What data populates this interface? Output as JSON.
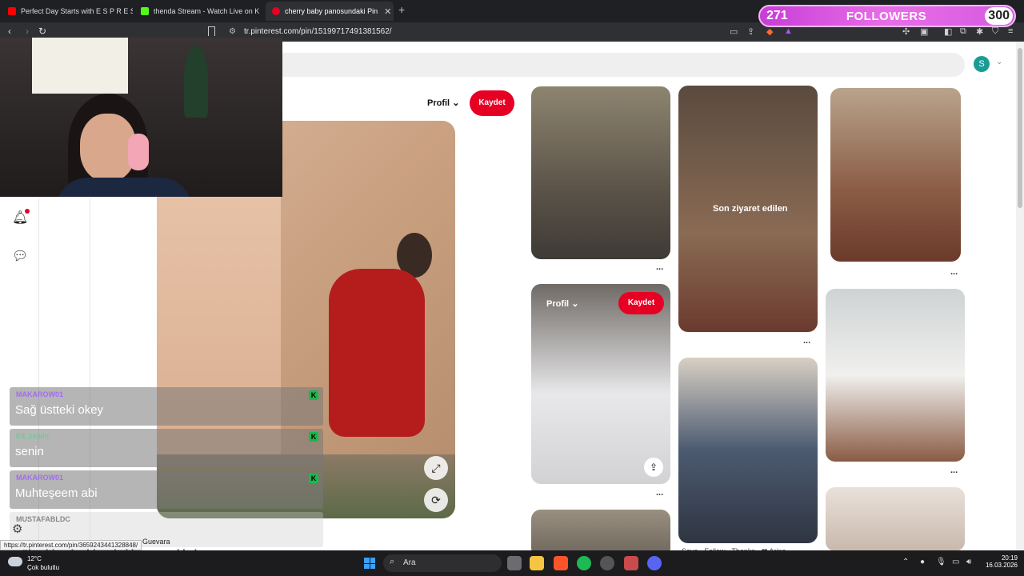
{
  "browser": {
    "tabs": [
      {
        "title": "Perfect Day Starts with E S P R E S S O",
        "icon_color": "#ff0000",
        "active": false
      },
      {
        "title": "thenda Stream - Watch Live on K",
        "icon_color": "#53fc18",
        "active": false
      },
      {
        "title": "cherry baby panosundaki Pin",
        "icon_color": "#e60023",
        "active": true
      }
    ],
    "url": "tr.pinterest.com/pin/151997174913815​62/",
    "status_url": "https://tr.pinterest.com/pin/36592434413288​48/"
  },
  "followers_widget": {
    "current": "271",
    "label": "FOLLOWERS",
    "goal": "300"
  },
  "pinterest": {
    "avatar_letter": "S",
    "pin": {
      "profile_label": "Profil",
      "save_label": "Kaydet"
    },
    "grid": {
      "recently_visited": "Son ziyaret edilen",
      "hover_profile": "Profil",
      "hover_save": "Kaydet",
      "more": "...",
      "footer_text": "Save · Follow · Thanks · ❤ Arina"
    }
  },
  "chat": [
    {
      "user": "MAKAROW01",
      "user_color": "#a46cf0",
      "text": "Sağ üstteki okey"
    },
    {
      "user": "Ell_zelvin",
      "user_color": "#5fd38f",
      "text": "senin"
    },
    {
      "user": "MAKAROW01",
      "user_color": "#a46cf0",
      "text": "Muhteşeem abi"
    },
    {
      "user": "MUSTAFABLDC",
      "user_color": "#888888",
      "text": "Guevara"
    }
  ],
  "chat_tail_text": "yükseltiyorlar biz erkekler paspal kalıyoruz",
  "taskbar": {
    "weather_temp": "12°C",
    "weather_desc": "Çok bulutlu",
    "search_label": "Ara",
    "time": "20:19",
    "date": "16.03.2026"
  },
  "colors": {
    "pinterest_red": "#e60023",
    "kick_green": "#53fc18",
    "followers_pink": "#e86ee8"
  }
}
